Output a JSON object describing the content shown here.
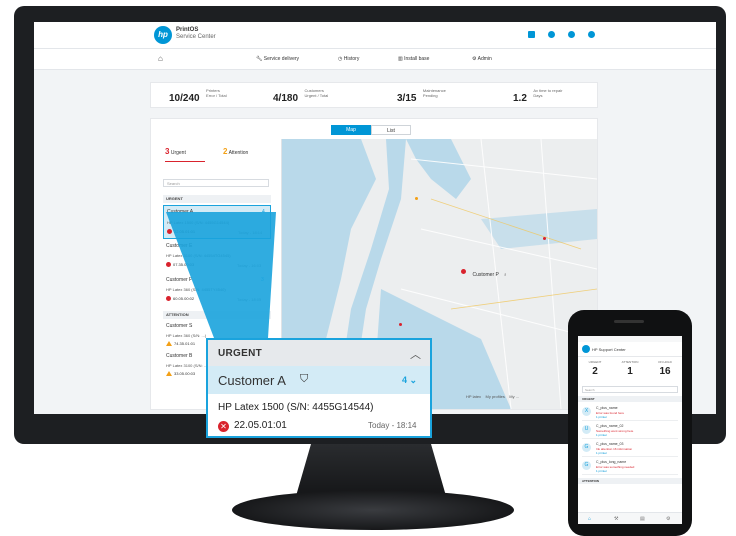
{
  "monitor": {
    "brand_logo": "hp",
    "screen": {
      "app": {
        "logo_text": "hp",
        "title_line1": "PrintOS",
        "title_line2": "Service Center"
      },
      "header_icons": [
        "grid-icon",
        "bell-icon",
        "help-icon",
        "user-icon"
      ],
      "nav": {
        "home_icon": "home-icon",
        "items": [
          {
            "label": "Service delivery",
            "icon": "wrench-icon"
          },
          {
            "label": "History",
            "icon": "clock-icon"
          },
          {
            "label": "Install base",
            "icon": "building-icon"
          },
          {
            "label": "Admin",
            "icon": "gear-icon"
          }
        ]
      },
      "stats": [
        {
          "big": "10/240",
          "l1": "Printers",
          "l2": "Error / Total"
        },
        {
          "big": "4/180",
          "l1": "Customers",
          "l2": "Urgent / Total"
        },
        {
          "big": "3/15",
          "l1": "Maintenance",
          "l2": "Pending"
        },
        {
          "big": "1.2",
          "l1": "Av time to repair",
          "l2": "Days"
        }
      ],
      "view_toggle": {
        "map": "Map",
        "list": "List"
      },
      "tabs": {
        "urgent_count": "3",
        "urgent_label": "Urgent",
        "attention_count": "2",
        "attention_label": "Attention"
      },
      "search_placeholder": "Search",
      "urgent_header": "URGENT",
      "attention_header": "ATTENTION",
      "rows": [
        {
          "customer": "Customer A",
          "device": "HP Latex 1500 (S/N: 4455G14544)",
          "error": "22.05.01:01",
          "time": "Today - 18:14",
          "count": "4"
        },
        {
          "customer": "Customer E",
          "device": "HP Latex 3100 (S/N: 44554TG4545)",
          "error": "07.35.00:03",
          "time": "Today - 16:03",
          "count": ""
        },
        {
          "customer": "Customer P",
          "device": "HP Latex 360 (S/N: 4455TY4540)",
          "error": "60.05.00:02",
          "time": "Today - 18:05",
          "count": "3"
        }
      ],
      "attention_rows": [
        {
          "customer": "Customer S",
          "device": "HP Latex 360 (S/N: ...)",
          "error": "74.35.01:01"
        },
        {
          "customer": "Customer B",
          "device": "HP Latex 3100 (S/N: ...)",
          "error": "33.05.00:03"
        }
      ],
      "map_pin_label": "Customer P",
      "footer": [
        "HP latex",
        "My profiles",
        "My ..."
      ]
    },
    "zoom_card": {
      "header": "URGENT",
      "customer": "Customer A",
      "count": "4",
      "device": "HP Latex 1500 (S/N: 4455G14544)",
      "error_code": "22.05.01:01",
      "time": "Today - 18:14"
    }
  },
  "phone": {
    "title": "HP Support Center",
    "stats": [
      {
        "label": "URGENT",
        "value": "2"
      },
      {
        "label": "ATTENTION",
        "value": "1"
      },
      {
        "label": "ON HOLD",
        "value": "16"
      }
    ],
    "search_placeholder": "Search",
    "urgent_header": "URGENT",
    "attention_header": "ATTENTION",
    "rows": [
      {
        "icon": "X",
        "name": "C_plus_name",
        "err": "Error was found here",
        "link": "1 printer"
      },
      {
        "icon": "U",
        "name": "C_plus_name_02",
        "err": "Something went wrong here",
        "link": "1 printer"
      },
      {
        "icon": "G",
        "name": "C_plus_name_03",
        "err": "Ink attention 16 information",
        "link": "1 printer"
      },
      {
        "icon": "G",
        "name": "C_plus_long_name",
        "err": "Error was something needed",
        "link": "1 printer"
      }
    ]
  },
  "colors": {
    "accent": "#0096d6",
    "error": "#d9232d",
    "warning": "#f3a016",
    "highlight": "#d3ebf6"
  }
}
